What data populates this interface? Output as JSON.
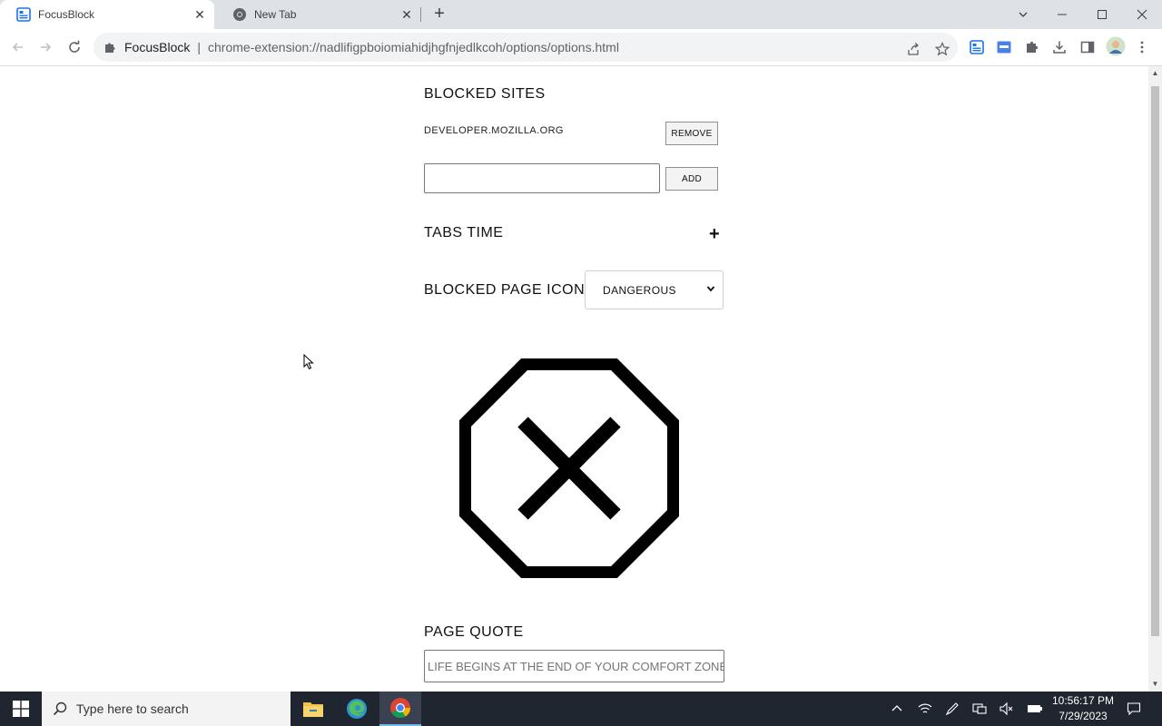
{
  "browser": {
    "tabs": [
      {
        "title": "FocusBlock",
        "favicon": "focusblock-icon",
        "active": true
      },
      {
        "title": "New Tab",
        "favicon": "chrome-icon",
        "active": false
      }
    ],
    "new_tab_symbol": "+",
    "omnibox": {
      "site_name": "FocusBlock",
      "divider": "|",
      "url": "chrome-extension://nadlifigpboiomiahidjhgfnjedlkcoh/options/options.html"
    }
  },
  "options": {
    "blocked_sites_title": "BLOCKED SITES",
    "blocked_sites": [
      {
        "domain": "DEVELOPER.MOZILLA.ORG",
        "remove_label": "REMOVE"
      }
    ],
    "site_input_value": "",
    "add_label": "ADD",
    "tabs_time_title": "TABS TIME",
    "tabs_time_toggle": "+",
    "blocked_icon_title": "BLOCKED PAGE ICON",
    "blocked_icon_selected": "DANGEROUS",
    "preview_icon": "stop-octagon-x-icon",
    "page_quote_title": "PAGE QUOTE",
    "page_quote_placeholder": "LIFE BEGINS AT THE END OF YOUR COMFORT ZONE"
  },
  "taskbar": {
    "search_placeholder": "Type here to search",
    "apps": [
      "file-explorer-icon",
      "edge-icon",
      "chrome-icon"
    ],
    "clock_time": "10:56:17 PM",
    "clock_date": "7/29/2023"
  }
}
